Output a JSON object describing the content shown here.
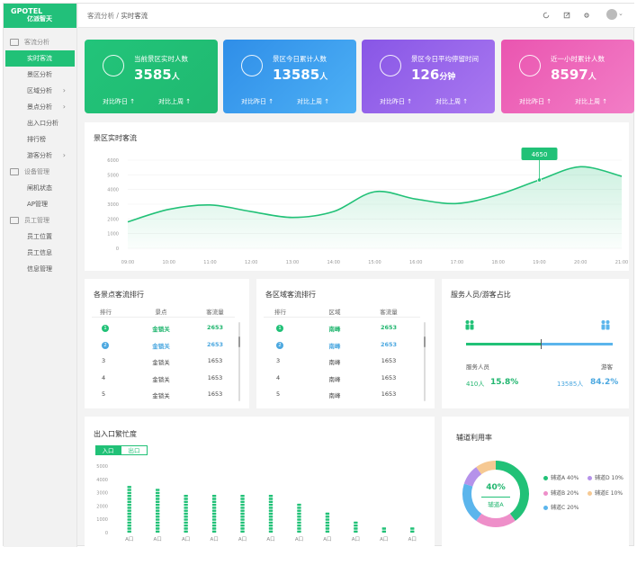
{
  "app": {
    "logo_text": "GPOTEL",
    "logo_sub": "亿派智天"
  },
  "sidebar": {
    "groups": [
      {
        "label": "客流分析",
        "items": [
          {
            "label": "实时客流",
            "chevron": ""
          },
          {
            "label": "景区分析",
            "chevron": ""
          },
          {
            "label": "区域分析",
            "chevron": "›"
          },
          {
            "label": "景点分析",
            "chevron": "›"
          },
          {
            "label": "出入口分析",
            "chevron": ""
          },
          {
            "label": "排行榜",
            "chevron": ""
          },
          {
            "label": "游客分析",
            "chevron": "›"
          }
        ]
      },
      {
        "label": "设备管理",
        "items": [
          {
            "label": "闸机状态",
            "chevron": ""
          },
          {
            "label": "AP管理",
            "chevron": ""
          }
        ]
      },
      {
        "label": "员工管理",
        "items": [
          {
            "label": "员工位置",
            "chevron": ""
          },
          {
            "label": "员工信息",
            "chevron": ""
          },
          {
            "label": "信息管理",
            "chevron": ""
          }
        ]
      }
    ]
  },
  "header": {
    "crumb_parent": "客流分析",
    "crumb_sep": "/",
    "crumb_current": "实时客流"
  },
  "cards": [
    {
      "title": "当前景区实时人数",
      "value": "3585",
      "unit": "人",
      "cmp1": "对比昨日 ↑",
      "cmp2": "对比上周 ↑",
      "icon": "user-icon"
    },
    {
      "title": "景区今日累计人数",
      "value": "13585",
      "unit": "人",
      "cmp1": "对比昨日 ↑",
      "cmp2": "对比上周 ↑",
      "icon": "user-icon"
    },
    {
      "title": "景区今日平均停留时间",
      "value": "126",
      "unit": "分钟",
      "cmp1": "对比昨日 ↑",
      "cmp2": "对比上周 ↑",
      "icon": "clock-icon"
    },
    {
      "title": "近一小时累计人数",
      "value": "8597",
      "unit": "人",
      "cmp1": "对比昨日 ↑",
      "cmp2": "对比上周 ↑",
      "icon": "user-icon"
    }
  ],
  "colors": {
    "green": "#21c177",
    "blue": "#3f9ff0",
    "purple": "#9a63ec",
    "pink": "#ee63b8"
  },
  "realtime": {
    "title": "景区实时客流",
    "tooltip": "4650",
    "chart_data": {
      "type": "area",
      "x": [
        "09:00",
        "10:00",
        "11:00",
        "12:00",
        "13:00",
        "14:00",
        "15:00",
        "16:00",
        "17:00",
        "18:00",
        "19:00",
        "20:00",
        "21:00"
      ],
      "yticks": [
        0,
        1000,
        2000,
        3000,
        4000,
        5000,
        6000
      ],
      "ylim": [
        0,
        6000
      ],
      "values": [
        1800,
        2650,
        2950,
        2500,
        2100,
        2500,
        3850,
        3350,
        3050,
        3650,
        4650,
        5550,
        4900
      ]
    }
  },
  "spots": {
    "title": "各景点客流排行",
    "headers": [
      "排行",
      "景点",
      "客流量"
    ],
    "rows": [
      {
        "rank": "1",
        "name": "金锁关",
        "value": "2653"
      },
      {
        "rank": "2",
        "name": "金锁关",
        "value": "2653"
      },
      {
        "rank": "3",
        "name": "金锁关",
        "value": "1653"
      },
      {
        "rank": "4",
        "name": "金锁关",
        "value": "1653"
      },
      {
        "rank": "5",
        "name": "金锁关",
        "value": "1653"
      }
    ]
  },
  "regions": {
    "title": "各区域客流排行",
    "headers": [
      "排行",
      "区域",
      "客流量"
    ],
    "rows": [
      {
        "rank": "1",
        "name": "南峰",
        "value": "2653"
      },
      {
        "rank": "2",
        "name": "南峰",
        "value": "2653"
      },
      {
        "rank": "3",
        "name": "南峰",
        "value": "1653"
      },
      {
        "rank": "4",
        "name": "南峰",
        "value": "1653"
      },
      {
        "rank": "5",
        "name": "南峰",
        "value": "1653"
      }
    ]
  },
  "ratio": {
    "title": "服务人员/游客占比",
    "staff_label": "服务人员",
    "visitor_label": "游客",
    "staff_count": "410人",
    "staff_pct": "15.8%",
    "visitor_count": "13585人",
    "visitor_pct": "84.2%",
    "staff_fraction": 0.158
  },
  "gates": {
    "title": "出入口繁忙度",
    "tabs": [
      "入口",
      "出口"
    ],
    "chart_data": {
      "type": "bar",
      "categories": [
        "A口",
        "A口",
        "A口",
        "A口",
        "A口",
        "A口",
        "A口",
        "A口",
        "A口",
        "A口",
        "A口"
      ],
      "values": [
        3550,
        3250,
        2900,
        2900,
        2900,
        2800,
        2300,
        1450,
        850,
        550,
        500
      ],
      "yticks": [
        0,
        1000,
        2000,
        3000,
        4000,
        5000
      ],
      "ylim": [
        0,
        5000
      ]
    }
  },
  "lanes": {
    "title": "辅道利用率",
    "center_value": "40%",
    "center_label": "辅道A",
    "chart_data": {
      "type": "pie",
      "labels": [
        "辅道A",
        "辅道B",
        "辅道C",
        "辅道D",
        "辅道E"
      ],
      "legend": [
        "辅道A  40%",
        "辅道B  20%",
        "辅道C  20%",
        "辅道D  10%",
        "辅道E  10%"
      ],
      "values": [
        40,
        20,
        20,
        10,
        10
      ],
      "colors": [
        "#21c177",
        "#ee8fc9",
        "#5bb5ec",
        "#b592ea",
        "#f6c993"
      ]
    }
  }
}
